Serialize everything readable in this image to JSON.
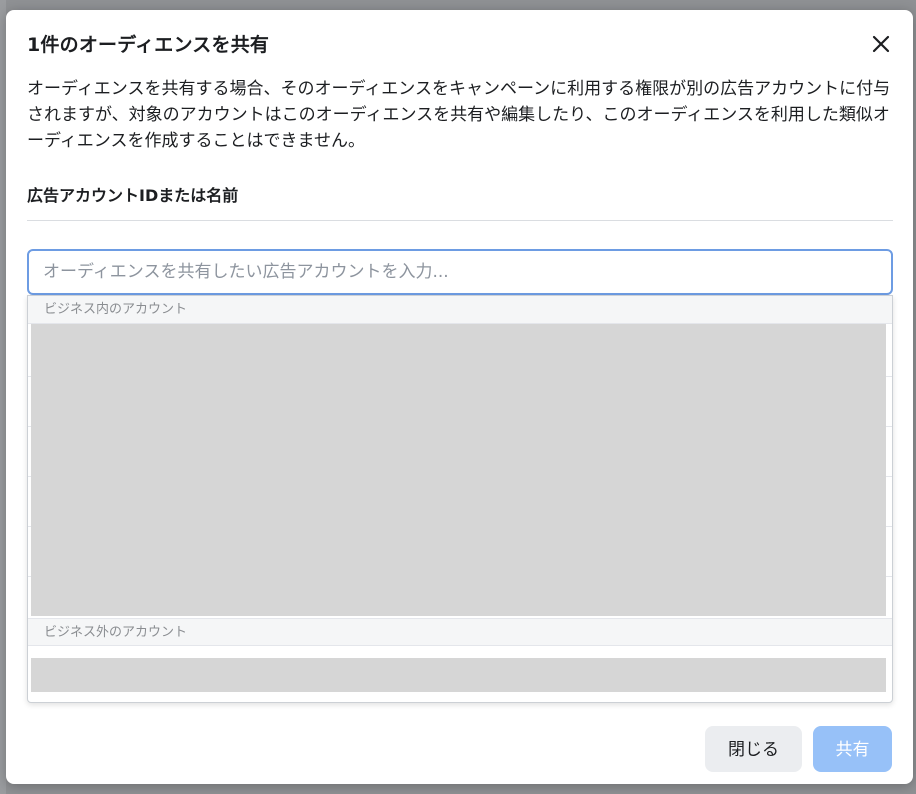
{
  "dialog": {
    "title": "1件のオーディエンスを共有",
    "description": "オーディエンスを共有する場合、そのオーディエンスをキャンペーンに利用する権限が別の広告アカウントに付与されますが、対象のアカウントはこのオーディエンスを共有や編集したり、このオーディエンスを利用した類似オーディエンスを作成することはできません。",
    "field_label": "広告アカウントIDまたは名前",
    "search": {
      "value": "",
      "placeholder": "オーディエンスを共有したい広告アカウントを入力..."
    },
    "dropdown": {
      "section_internal": "ビジネス内のアカウント",
      "section_external": "ビジネス外のアカウント"
    },
    "buttons": {
      "close_label": "閉じる",
      "share_label": "共有"
    }
  },
  "icons": {
    "close": "close-icon"
  },
  "colors": {
    "accent_disabled": "#97c1f8",
    "input_focus_border": "#6d9ce3"
  }
}
